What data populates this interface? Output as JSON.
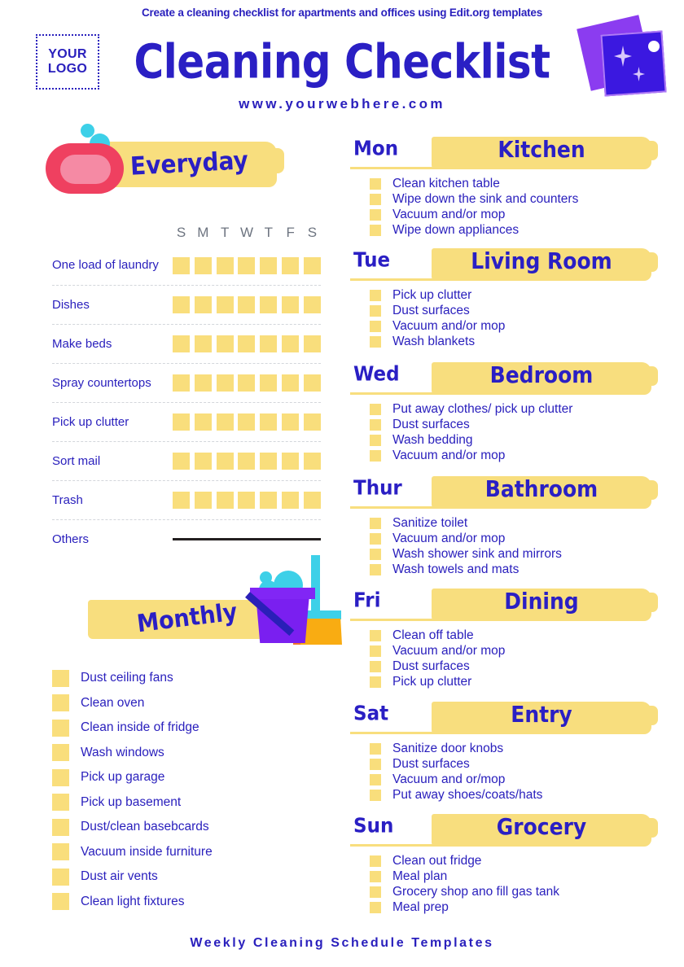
{
  "header": {
    "caption": "Create a cleaning checklist for apartments and offices using Edit.org templates",
    "logo_line1": "YOUR",
    "logo_line2": "LOGO",
    "title": "Cleaning Checklist",
    "website": "www.yourwebhere.com"
  },
  "everyday": {
    "label": "Everyday",
    "day_initials": [
      "S",
      "M",
      "T",
      "W",
      "T",
      "F",
      "S"
    ],
    "tasks": [
      {
        "name": "One load of laundry",
        "boxes": 7
      },
      {
        "name": "Dishes",
        "boxes": 7
      },
      {
        "name": "Make beds",
        "boxes": 7
      },
      {
        "name": "Spray countertops",
        "boxes": 7
      },
      {
        "name": "Pick up clutter",
        "boxes": 7
      },
      {
        "name": "Sort mail",
        "boxes": 7
      },
      {
        "name": "Trash",
        "boxes": 7
      },
      {
        "name": "Others",
        "boxes": 0
      }
    ]
  },
  "monthly": {
    "label": "Monthly",
    "items": [
      "Dust ceiling fans",
      "Clean oven",
      "Clean inside of fridge",
      "Wash windows",
      "Pick up garage",
      "Pick up basement",
      "Dust/clean basebcards",
      "Vacuum inside furniture",
      "Dust air vents",
      "Clean light fixtures"
    ]
  },
  "days": [
    {
      "day": "Mon",
      "room": "Kitchen",
      "items": [
        "Clean kitchen table",
        "Wipe down the sink and counters",
        "Vacuum and/or mop",
        "Wipe down appliances"
      ]
    },
    {
      "day": "Tue",
      "room": "Living Room",
      "items": [
        "Pick up clutter",
        "Dust surfaces",
        "Vacuum and/or mop",
        "Wash blankets"
      ]
    },
    {
      "day": "Wed",
      "room": "Bedroom",
      "items": [
        "Put away clothes/ pick up clutter",
        "Dust surfaces",
        "Wash bedding",
        "Vacuum and/or mop"
      ]
    },
    {
      "day": "Thur",
      "room": "Bathroom",
      "items": [
        "Sanitize toilet",
        "Vacuum and/or mop",
        "Wash shower sink and mirrors",
        "Wash towels and mats"
      ]
    },
    {
      "day": "Fri",
      "room": "Dining",
      "items": [
        "Clean off table",
        "Vacuum and/or mop",
        "Dust surfaces",
        "Pick up clutter"
      ]
    },
    {
      "day": "Sat",
      "room": "Entry",
      "items": [
        "Sanitize door knobs",
        "Dust surfaces",
        "Vacuum and or/mop",
        "Put away shoes/coats/hats"
      ]
    },
    {
      "day": "Sun",
      "room": "Grocery",
      "items": [
        "Clean out fridge",
        "Meal plan",
        "Grocery shop ano fill gas tank",
        "Meal prep"
      ]
    }
  ],
  "footer": {
    "text": "Weekly Cleaning Schedule Templates"
  },
  "colors": {
    "ink_blue": "#2a20bd",
    "title_blue": "#2a1fc4",
    "highlight_yellow": "#f8de7e",
    "checkbox_yellow": "#f9de7c",
    "sponge_pink": "#ef4060",
    "bubble_cyan": "#3dd0e8",
    "bucket_purple": "#7a1ff0",
    "mop_orange": "#f9ac12"
  }
}
